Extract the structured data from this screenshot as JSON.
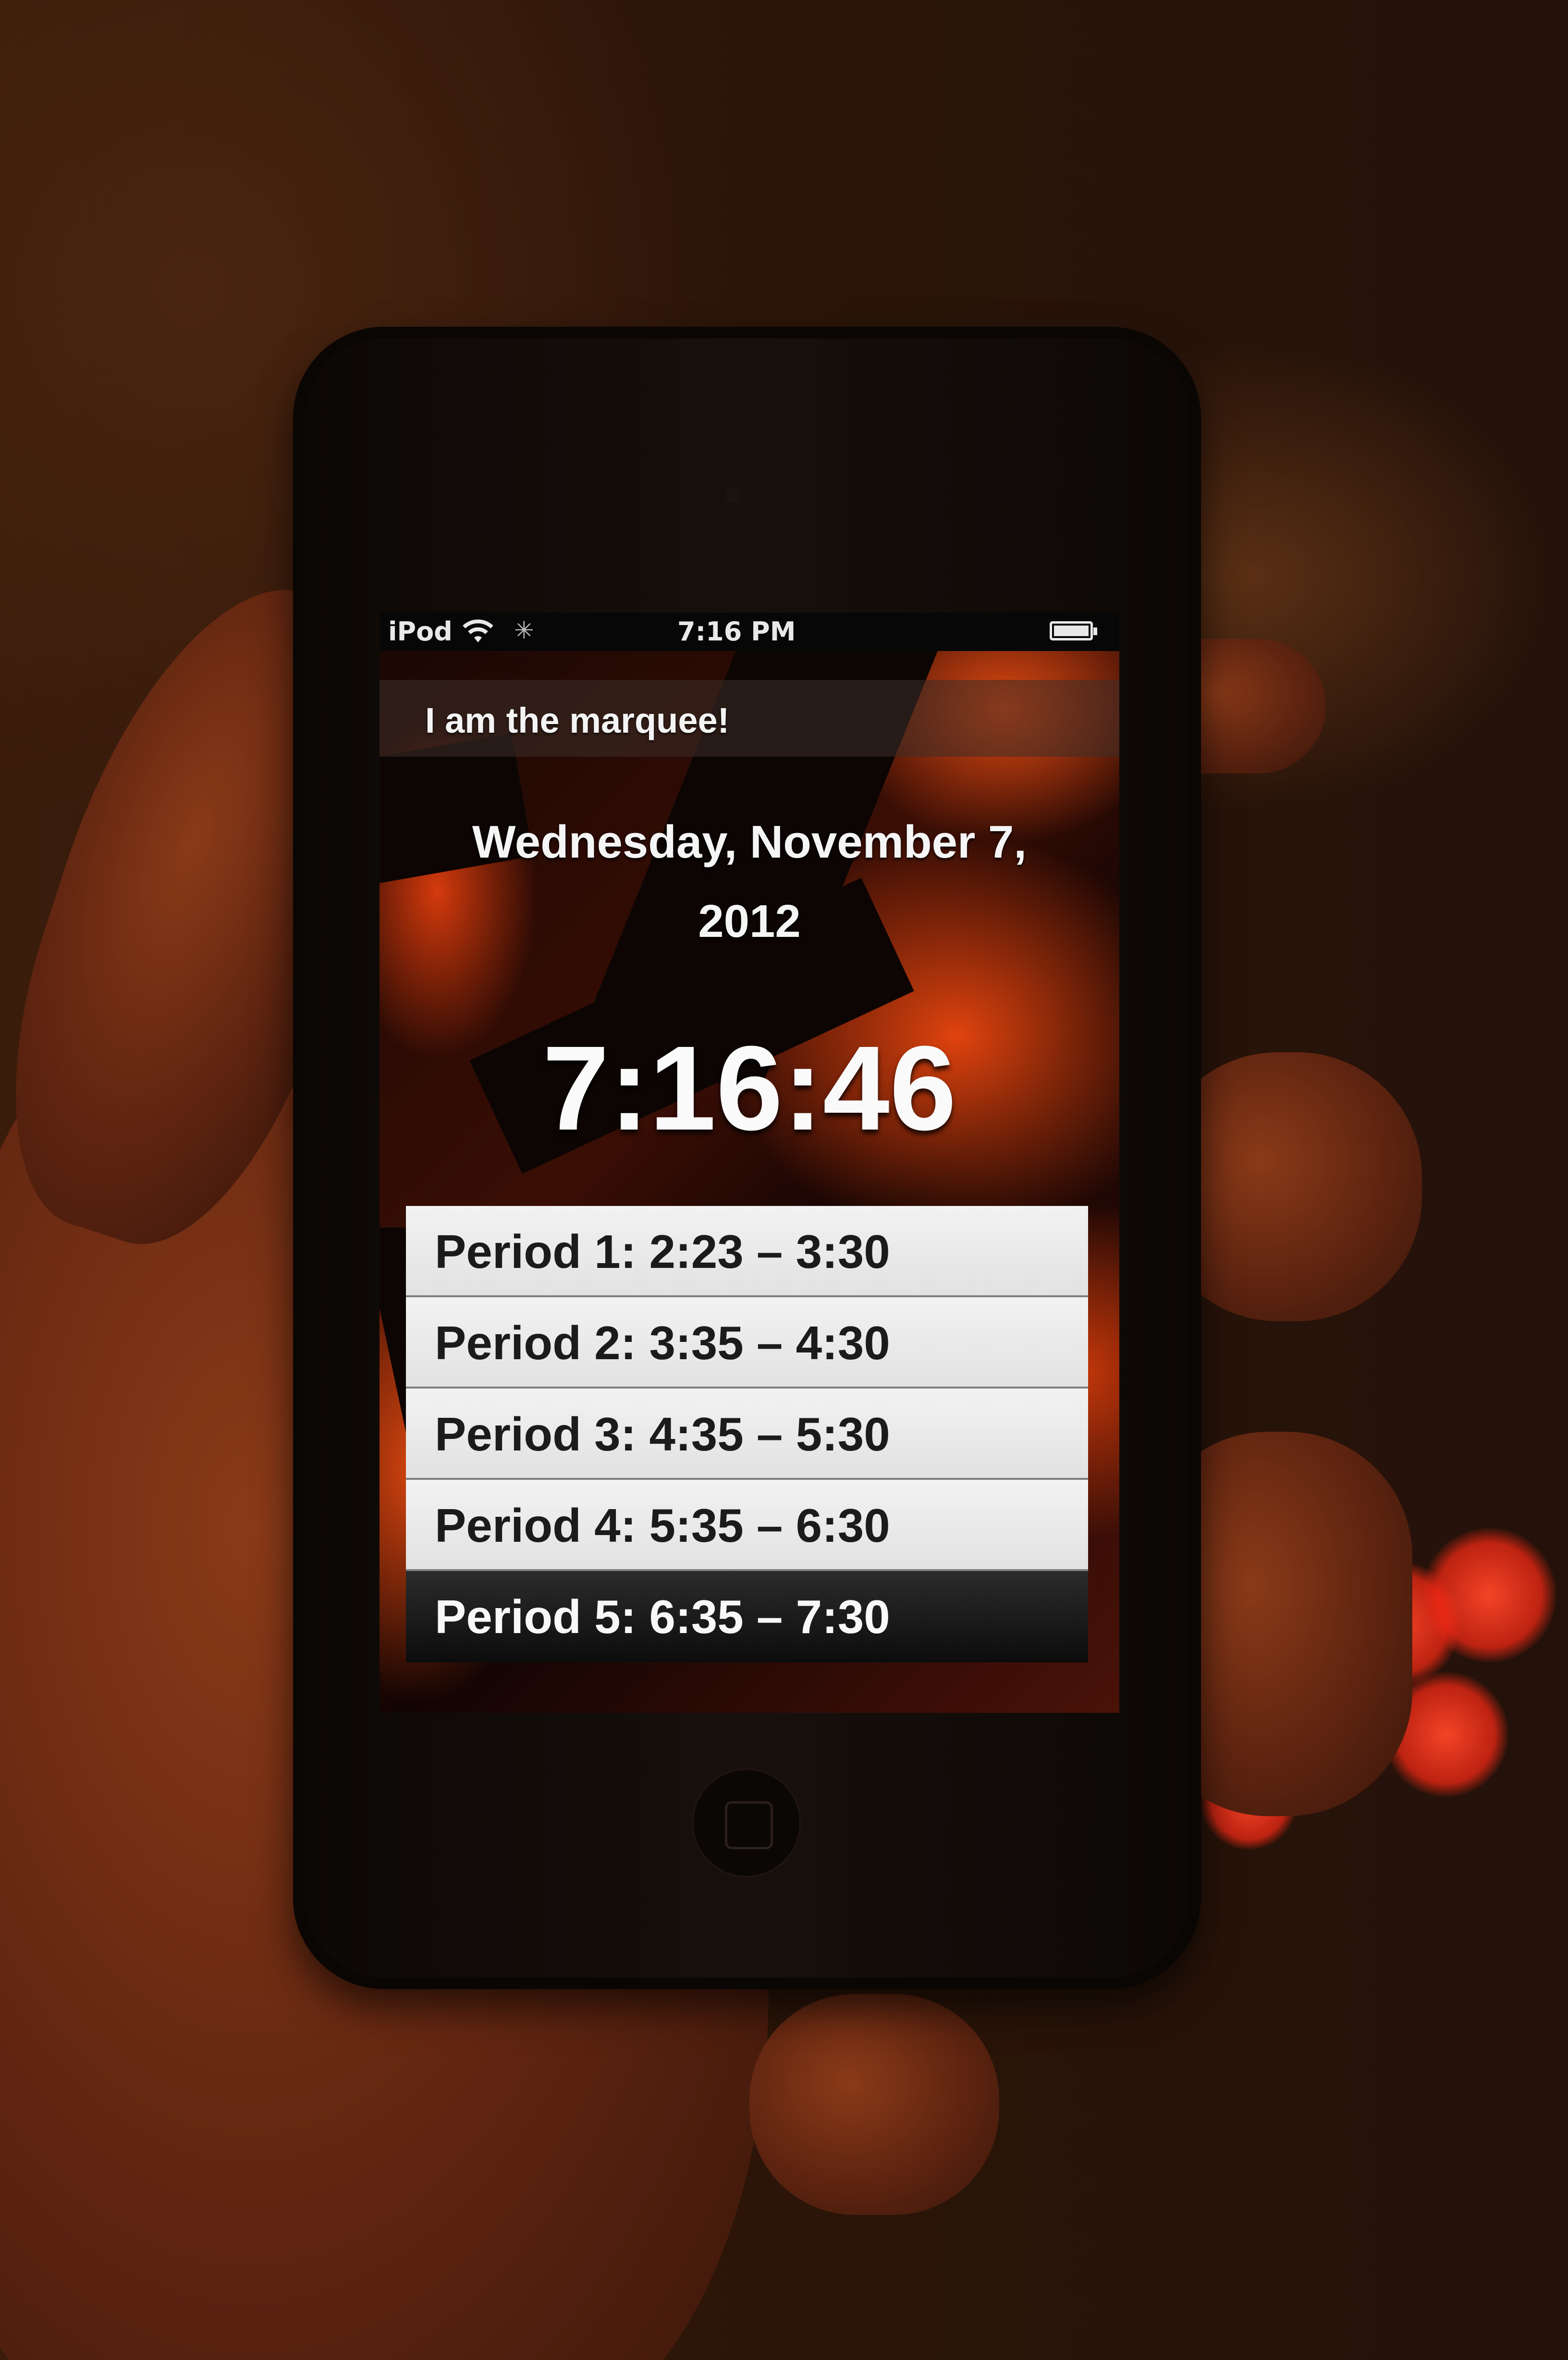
{
  "status_bar": {
    "carrier": "iPod",
    "time": "7:16 PM"
  },
  "marquee": {
    "text": "I am the marquee!"
  },
  "date": {
    "line1": "Wednesday, November 7,",
    "line2": "2012"
  },
  "clock": {
    "time": "7:16:46"
  },
  "periods": [
    {
      "label": "Period 1: 2:23 – 3:30"
    },
    {
      "label": "Period 2: 3:35 – 4:30"
    },
    {
      "label": "Period 3: 4:35 – 5:30"
    },
    {
      "label": "Period 4: 5:35 – 6:30"
    },
    {
      "label": "Period 5: 6:35 – 7:30"
    }
  ],
  "active_period_index": 4,
  "colors": {
    "wallpaper_accent": "#e0430e",
    "row_background": "#eeeeee",
    "active_row_background": "#111111"
  },
  "icons": [
    "wifi-icon",
    "activity-spinner-icon",
    "battery-icon",
    "home-button-icon"
  ]
}
